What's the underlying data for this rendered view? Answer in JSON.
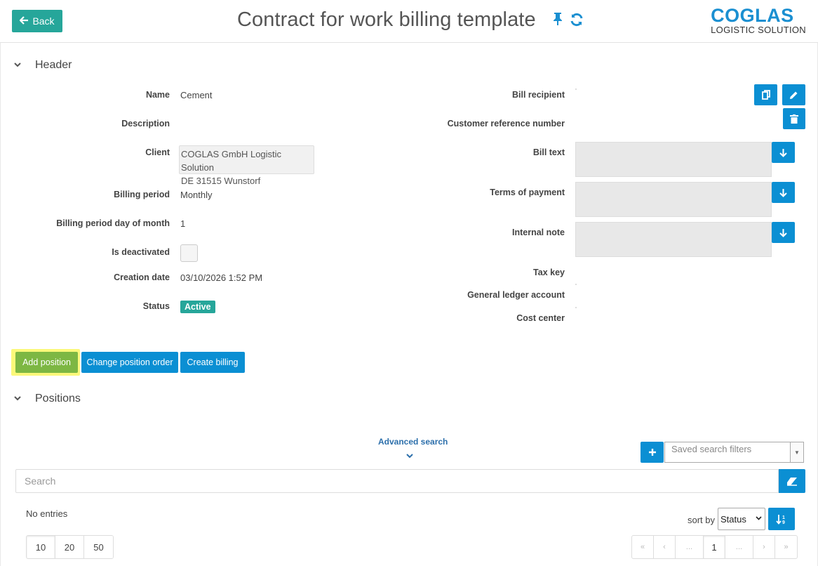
{
  "topbar": {
    "back_label": "Back",
    "title": "Contract for work billing template",
    "logo_main": "COGLAS",
    "logo_sub": "LOGISTIC SOLUTION"
  },
  "header_section": {
    "title": "Header",
    "fields_left": {
      "name_label": "Name",
      "name_value": "Cement",
      "description_label": "Description",
      "client_label": "Client",
      "client_line1": "COGLAS GmbH Logistic Solution",
      "client_line2": "DE 31515 Wunstorf",
      "billing_period_label": "Billing period",
      "billing_period_value": "Monthly",
      "billing_day_label": "Billing period day of month",
      "billing_day_value": "1",
      "deactivated_label": "Is deactivated",
      "creation_date_label": "Creation date",
      "creation_date_value": "03/10/2026 1:52 PM",
      "status_label": "Status",
      "status_value": "Active"
    },
    "fields_right": {
      "bill_recipient_label": "Bill recipient",
      "customer_ref_label": "Customer reference number",
      "bill_text_label": "Bill text",
      "terms_label": "Terms of payment",
      "internal_note_label": "Internal note",
      "tax_key_label": "Tax key",
      "gl_account_label": "General ledger account",
      "cost_center_label": "Cost center"
    }
  },
  "actions": {
    "add_position": "Add position",
    "change_order": "Change position order",
    "create_billing": "Create billing"
  },
  "positions_section": {
    "title": "Positions",
    "advanced_search": "Advanced search",
    "saved_filters_placeholder": "Saved search filters",
    "search_placeholder": "Search",
    "no_entries": "No entries",
    "sort_by_label": "sort by",
    "sort_by_value": "Status",
    "page_sizes": [
      "10",
      "20",
      "50"
    ],
    "pagination": {
      "first": "«",
      "prev": "‹",
      "ellipsis": "...",
      "current": "1",
      "next": "›",
      "last": "»"
    }
  },
  "colors": {
    "teal": "#26a69a",
    "blue": "#0b8fd3",
    "green": "#7db743",
    "highlight": "#fbf87a",
    "logo": "#1a8fd1"
  }
}
